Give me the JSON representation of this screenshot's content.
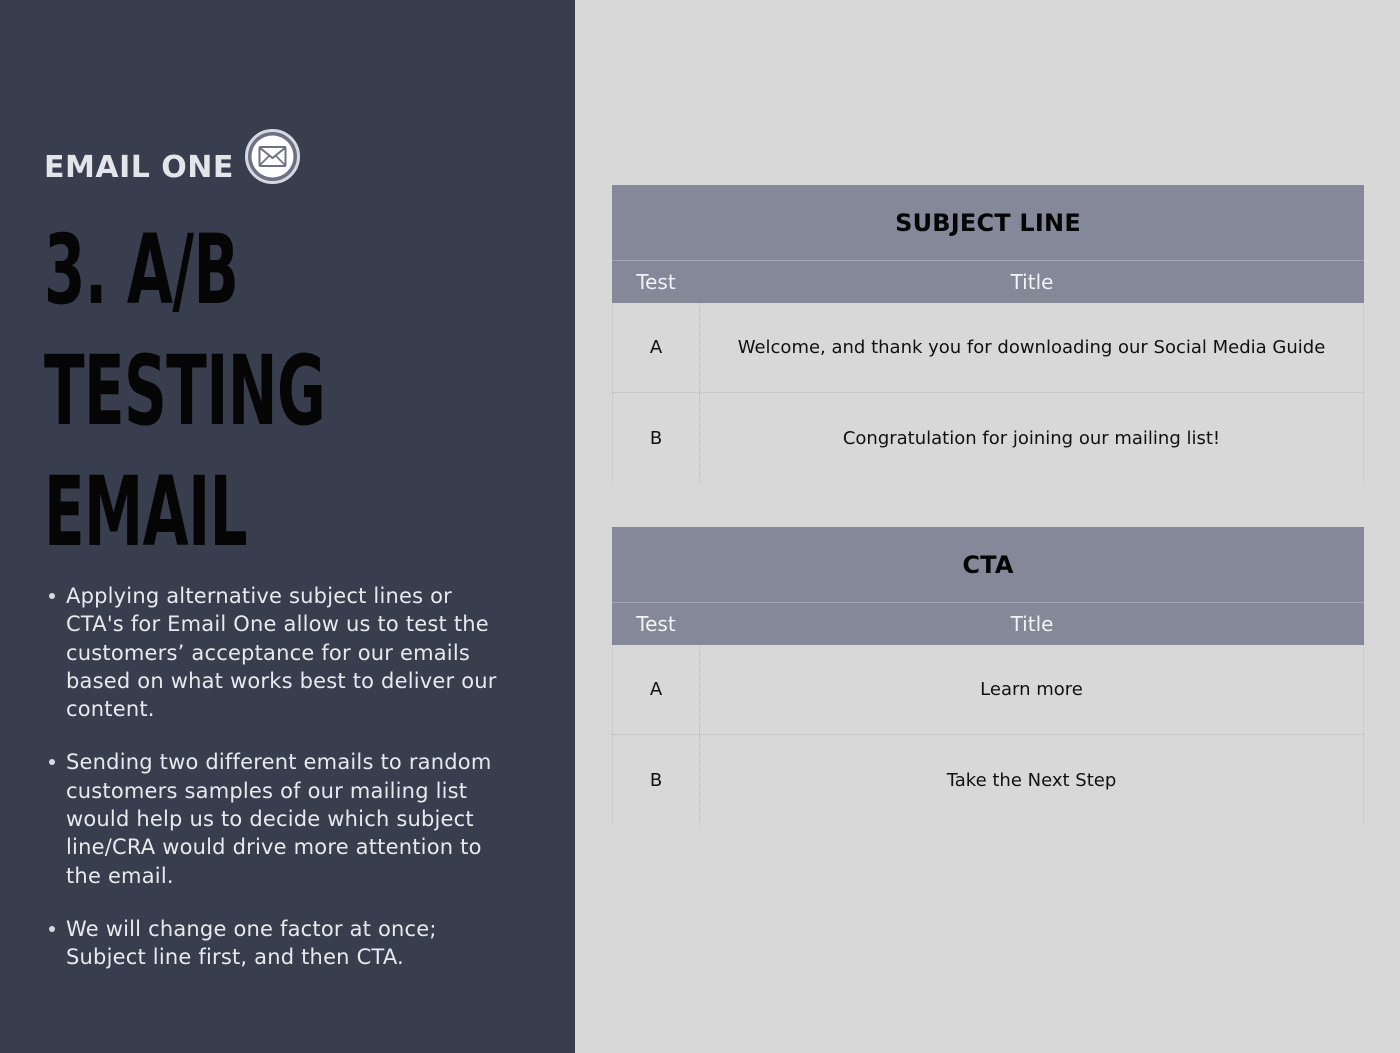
{
  "slide": {
    "kicker": "EMAIL ONE",
    "badge_icon": "envelope-icon",
    "headline_lines": [
      "3. A/B",
      "TESTING",
      "EMAIL"
    ],
    "bullets": [
      "Applying alternative subject lines or CTA's for Email One allow us to test the customers’ acceptance for our emails based on what works best to deliver our content.",
      "Sending two different emails to random customers samples of our mailing list would help us to decide which subject line/CRA would drive more attention to the email.",
      "We will change one factor at once; Subject line first, and then CTA."
    ]
  },
  "tables": [
    {
      "heading": "SUBJECT LINE",
      "col_test": "Test",
      "col_title": "Title",
      "rows": [
        {
          "test": "A",
          "title": "Welcome, and thank you for downloading our Social Media Guide"
        },
        {
          "test": "B",
          "title": "Congratulation for joining our mailing list!"
        }
      ]
    },
    {
      "heading": "CTA",
      "col_test": "Test",
      "col_title": "Title",
      "rows": [
        {
          "test": "A",
          "title": "Learn more"
        },
        {
          "test": "B",
          "title": "Take the Next Step"
        }
      ]
    }
  ],
  "colors": {
    "left_panel": "#383e4d",
    "right_panel": "#d8d8d8",
    "table_header": "#848899"
  }
}
